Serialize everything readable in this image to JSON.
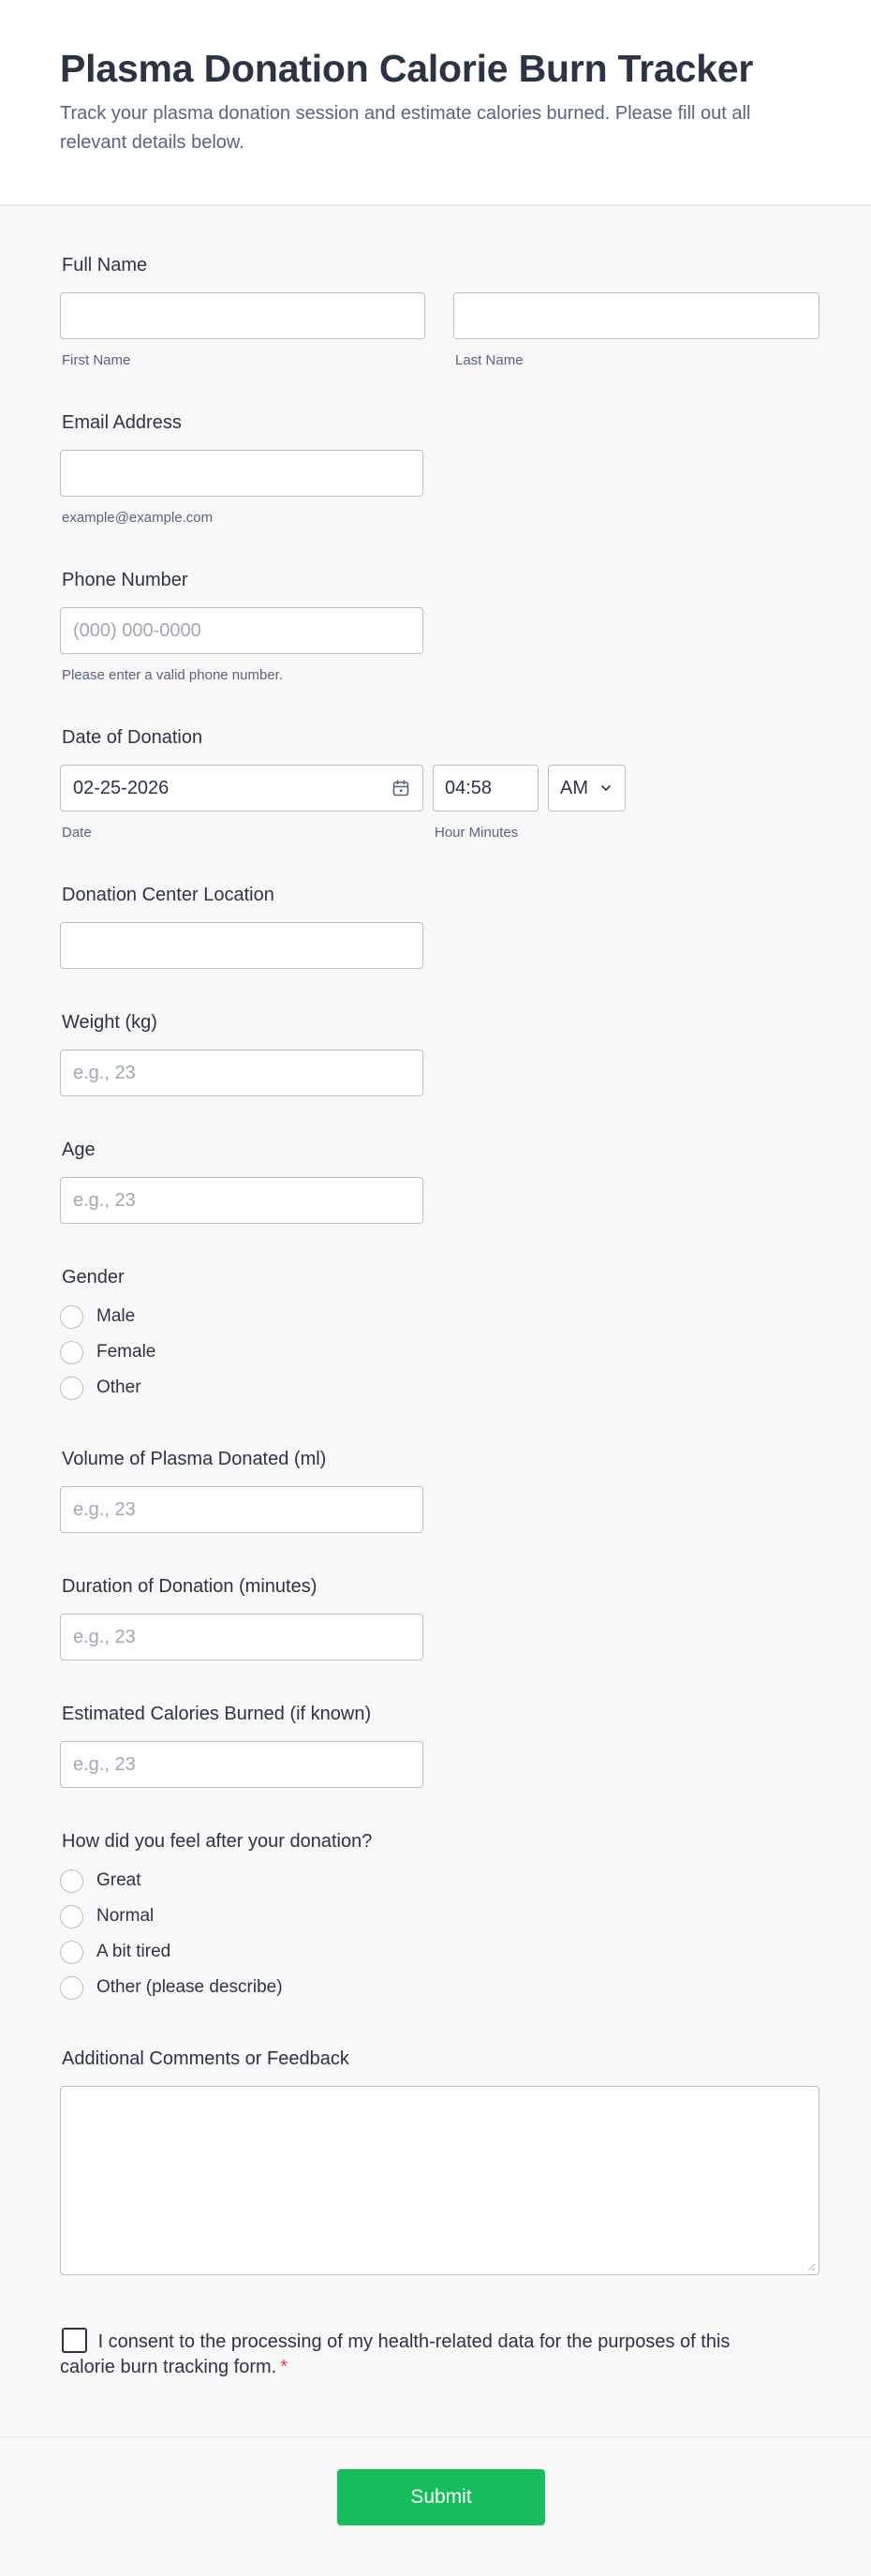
{
  "header": {
    "title": "Plasma Donation Calorie Burn Tracker",
    "description": "Track your plasma donation session and estimate calories burned. Please fill out all relevant details below."
  },
  "full_name": {
    "label": "Full Name",
    "first_sublabel": "First Name",
    "last_sublabel": "Last Name"
  },
  "email": {
    "label": "Email Address",
    "sublabel": "example@example.com"
  },
  "phone": {
    "label": "Phone Number",
    "placeholder": "(000) 000-0000",
    "sublabel": "Please enter a valid phone number."
  },
  "donation_date": {
    "label": "Date of Donation",
    "date_value": "02-25-2026",
    "time_value": "04:58",
    "ampm_value": "AM",
    "date_sublabel": "Date",
    "time_sublabel": "Hour Minutes"
  },
  "location": {
    "label": "Donation Center Location"
  },
  "weight": {
    "label": "Weight (kg)",
    "placeholder": "e.g., 23"
  },
  "age": {
    "label": "Age",
    "placeholder": "e.g., 23"
  },
  "gender": {
    "label": "Gender",
    "options": [
      "Male",
      "Female",
      "Other"
    ]
  },
  "volume": {
    "label": "Volume of Plasma Donated (ml)",
    "placeholder": "e.g., 23"
  },
  "duration": {
    "label": "Duration of Donation (minutes)",
    "placeholder": "e.g., 23"
  },
  "calories": {
    "label": "Estimated Calories Burned (if known)",
    "placeholder": "e.g., 23"
  },
  "feeling": {
    "label": "How did you feel after your donation?",
    "options": [
      "Great",
      "Normal",
      "A bit tired",
      "Other (please describe)"
    ]
  },
  "comments": {
    "label": "Additional Comments or Feedback"
  },
  "consent": {
    "text": "I consent to the processing of my health-related data for the purposes of this calorie burn tracking form.",
    "required_mark": "*"
  },
  "submit_label": "Submit",
  "colors": {
    "accent": "#18bd5b",
    "required": "#f23a3c",
    "text": "#2c3345",
    "muted": "#57647e"
  }
}
